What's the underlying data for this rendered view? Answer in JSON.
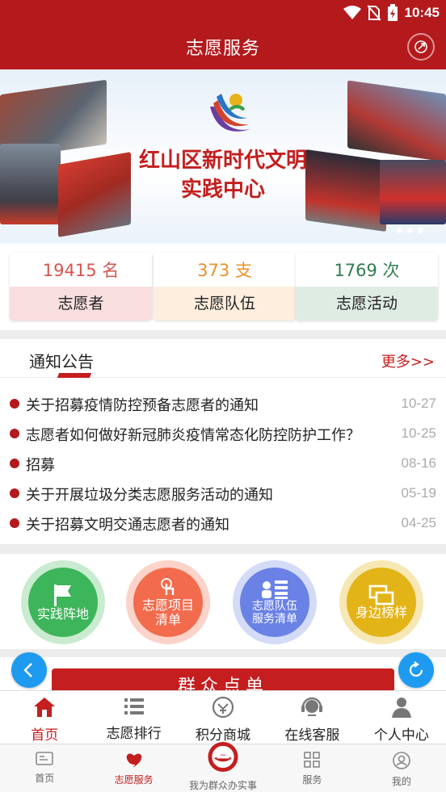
{
  "status": {
    "time": "10:45"
  },
  "header": {
    "title": "志愿服务"
  },
  "banner": {
    "line1": "红山区新时代文明",
    "line2": "实践中心"
  },
  "stats": [
    {
      "value": "19415 名",
      "label": "志愿者",
      "value_color": "#d9534f",
      "bg": "#f8dede"
    },
    {
      "value": "373 支",
      "label": "志愿队伍",
      "value_color": "#e8912a",
      "bg": "#fdeedd"
    },
    {
      "value": "1769 次",
      "label": "志愿活动",
      "value_color": "#2f7d4f",
      "bg": "#dfece3"
    }
  ],
  "notices": {
    "title": "通知公告",
    "more": "更多>>",
    "items": [
      {
        "text": "关于招募疫情防控预备志愿者的通知",
        "date": "10-27"
      },
      {
        "text": "志愿者如何做好新冠肺炎疫情常态化防控防护工作？",
        "date": "10-25"
      },
      {
        "text": "招募",
        "date": "08-16"
      },
      {
        "text": "关于开展垃圾分类志愿服务活动的通知",
        "date": "05-19"
      },
      {
        "text": "关于招募文明交通志愿者的通知",
        "date": "04-25"
      }
    ]
  },
  "functions": [
    {
      "label": "实践阵地",
      "icon": "flag-icon",
      "color": "#3db55a",
      "ring": "#c9ebcf"
    },
    {
      "label_line1": "志愿项目",
      "label_line2": "清单",
      "icon": "touch-icon",
      "color": "#f26b4c",
      "ring": "#fbd3c9"
    },
    {
      "label_line1": "志愿队伍",
      "label_line2": "服务清单",
      "icon": "team-list-icon",
      "color": "#6a82e6",
      "ring": "#d3dbf7"
    },
    {
      "label": "身边榜样",
      "icon": "windows-icon",
      "color": "#e3b418",
      "ring": "#f6e7b4"
    }
  ],
  "action_button": "群众点单",
  "inner_tabs": [
    {
      "label": "首页",
      "icon": "home-icon",
      "active": true
    },
    {
      "label": "志愿排行",
      "icon": "ranking-list-icon",
      "active": false
    },
    {
      "label": "积分商城",
      "icon": "mall-icon",
      "active": false
    },
    {
      "label": "在线客服",
      "icon": "headset-icon",
      "active": false
    },
    {
      "label": "个人中心",
      "icon": "person-icon",
      "active": false
    }
  ],
  "outer_tabs": [
    {
      "label": "首页",
      "icon": "home-card-icon",
      "active": false
    },
    {
      "label": "志愿服务",
      "icon": "heart-hands-icon",
      "active": true
    },
    {
      "label": "我为群众办实事",
      "icon": "emblem-icon",
      "active": false
    },
    {
      "label": "服务",
      "icon": "grid-icon",
      "active": false
    },
    {
      "label": "我的",
      "icon": "user-circle-icon",
      "active": false
    }
  ],
  "colors": {
    "brand_red": "#b4191c",
    "accent_blue": "#1e9bf0"
  }
}
